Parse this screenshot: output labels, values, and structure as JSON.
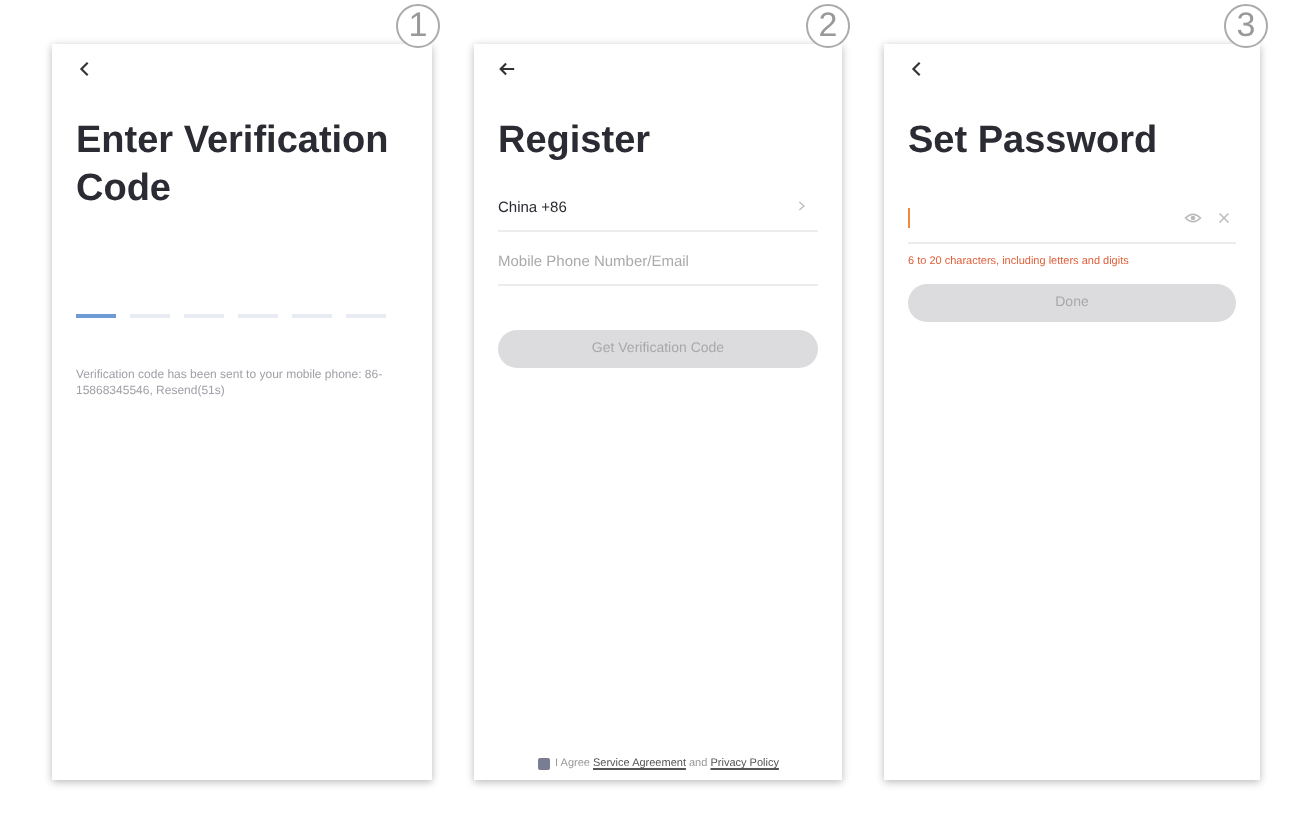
{
  "screens": [
    {
      "kind": "verify",
      "number": "1",
      "title": "Enter Verification Code",
      "code_slots": [
        {
          "selected": true
        },
        {
          "selected": false
        },
        {
          "selected": false
        },
        {
          "selected": false
        },
        {
          "selected": false
        },
        {
          "selected": false
        }
      ],
      "message": "Verification code has been sent to your mobile phone: 86-15868345546, Resend(51s)"
    },
    {
      "kind": "register",
      "number": "2",
      "title": "Register",
      "country": "China +86",
      "phone_field": {
        "placeholder": "Mobile Phone Number/Email"
      },
      "button": {
        "label": "Get Verification Code",
        "disabled": true
      },
      "agreement": {
        "checked": true,
        "parts": [
          {
            "kind": "text",
            "text": "I Agree"
          },
          {
            "kind": "link",
            "text": "Service Agreement"
          },
          {
            "kind": "text",
            "text": "and"
          },
          {
            "kind": "link",
            "text": "Privacy Policy"
          }
        ]
      }
    },
    {
      "kind": "password",
      "number": "3",
      "title": "Set Password",
      "hint": "6 to 20 characters, including letters and digits",
      "button": {
        "label": "Done",
        "disabled": true
      }
    }
  ]
}
